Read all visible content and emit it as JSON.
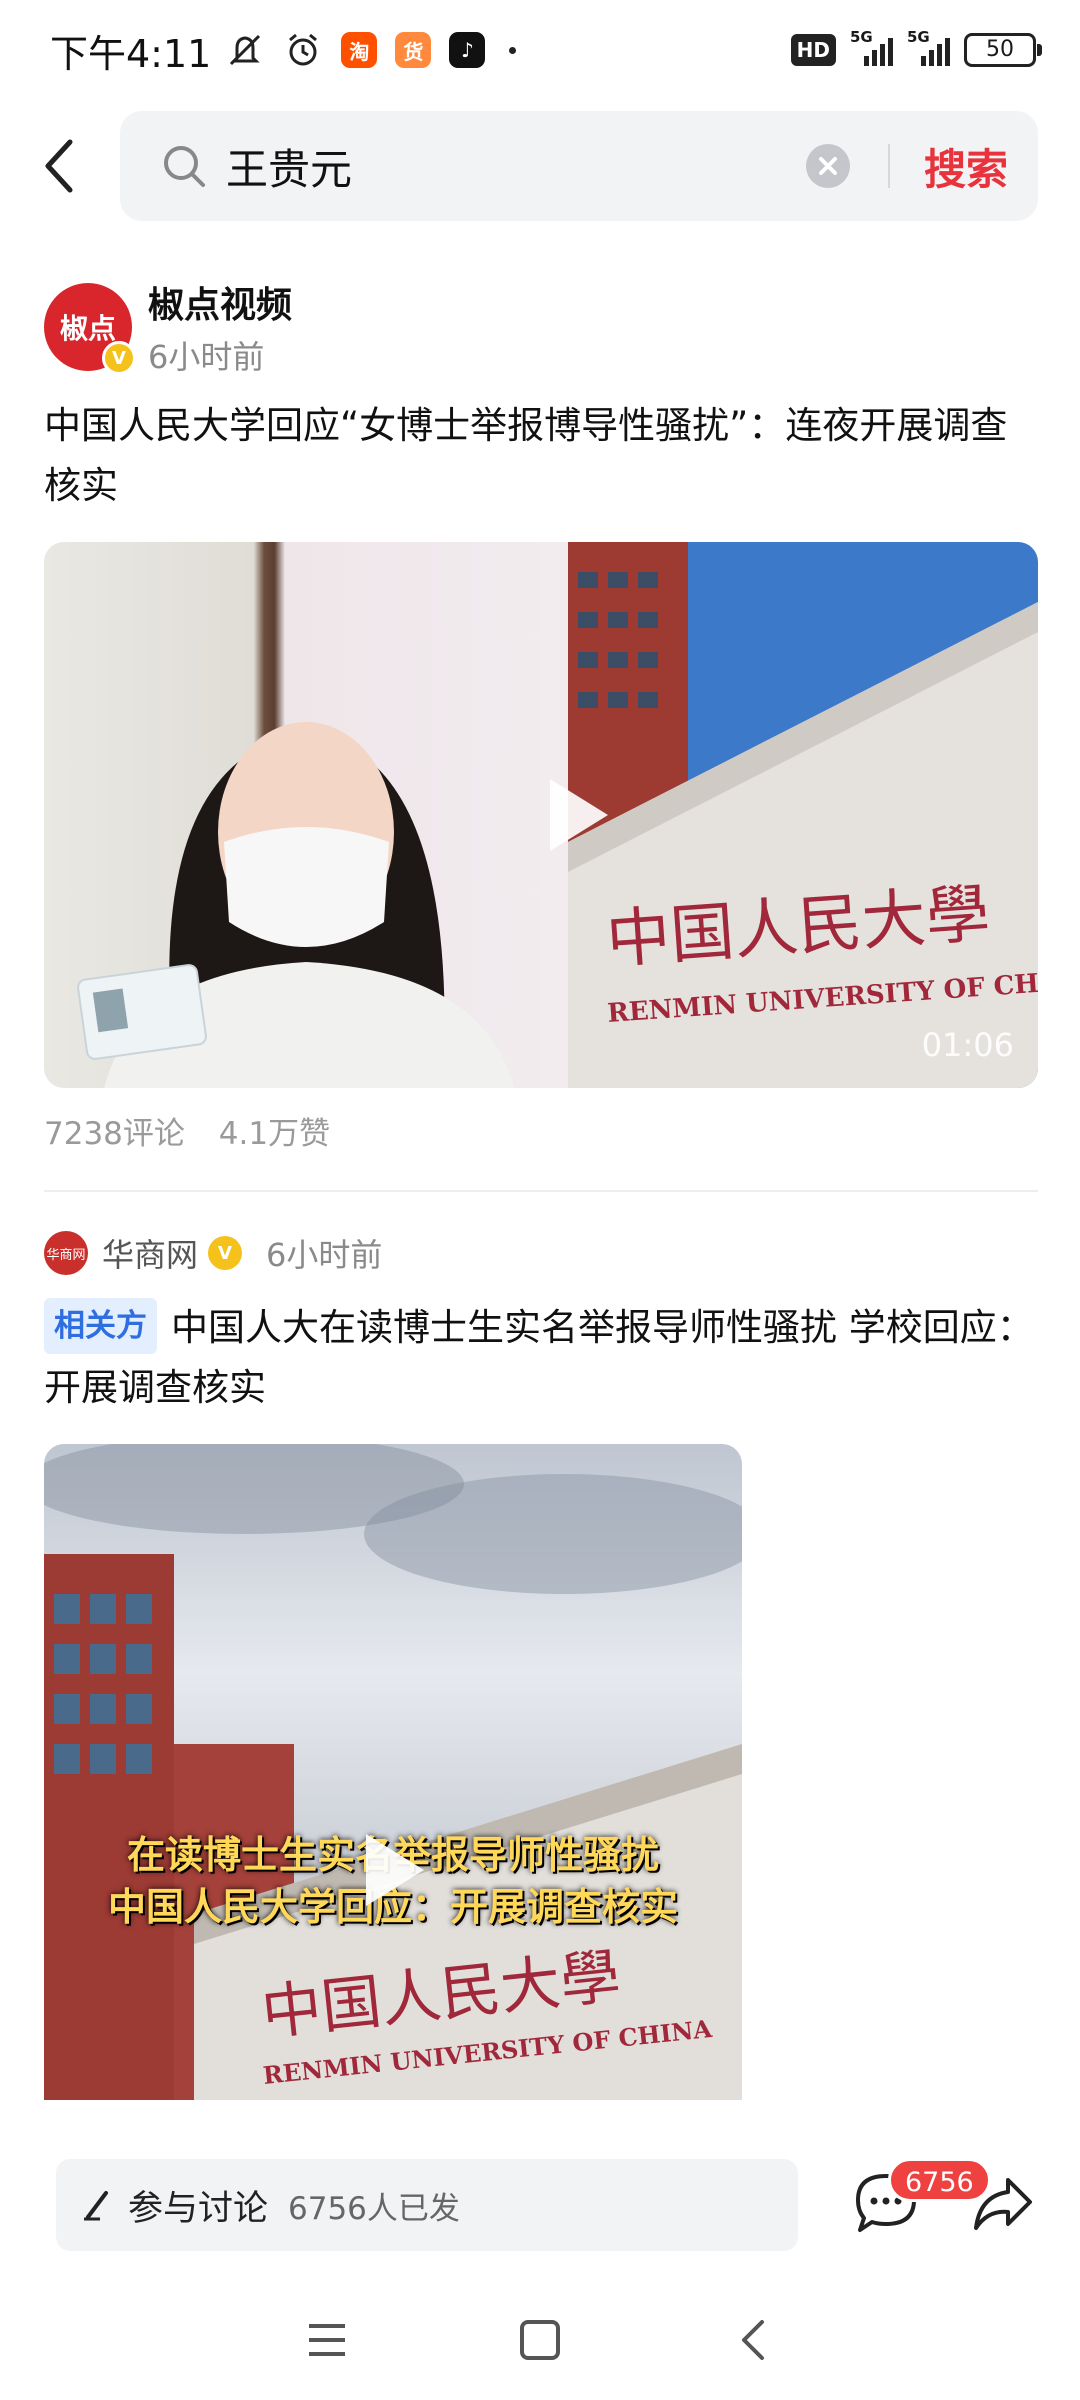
{
  "status_bar": {
    "time": "下午4:11",
    "apps": [
      {
        "name": "taobao-app-icon",
        "glyph": "淘",
        "color": "#ff5000"
      },
      {
        "name": "shopping-app-icon",
        "glyph": "货",
        "color": "#ff8a3d"
      },
      {
        "name": "tiktok-app-icon",
        "glyph": "♪",
        "color": "#111111"
      }
    ],
    "hd_label": "HD",
    "network_1": "5G",
    "network_2": "5G",
    "battery": "50"
  },
  "search": {
    "query": "王贵元",
    "submit_label": "搜索"
  },
  "posts": [
    {
      "author": "椒点视频",
      "avatar_text": "椒点",
      "verified_mark": "V",
      "time": "6小时前",
      "headline": "中国人民大学回应“女博士举报博导性骚扰”：连夜开展调查核实",
      "duration": "01:06",
      "comments": "7238评论",
      "likes": "4.1万赞",
      "sign_cn": "中国人民大學",
      "sign_en": "RENMIN UNIVERSITY OF CHINA"
    },
    {
      "author": "华商网",
      "avatar_text": "华商网",
      "verified_mark": "V",
      "time": "6小时前",
      "tag": "相关方",
      "headline": "中国人大在读博士生实名举报导师性骚扰 学校回应：开展调查核实",
      "overlay_line1": "在读博士生实名举报导师性骚扰",
      "overlay_line2": "中国人民大学回应：开展调查核实",
      "sign_cn": "中国人民大學",
      "sign_en": "RENMIN UNIVERSITY OF CHINA"
    }
  ],
  "comment_bar": {
    "label": "参与讨论",
    "count": "6756人已发",
    "badge": "6756"
  },
  "colors": {
    "accent": "#e8323c",
    "badge": "#f04141",
    "tag_bg": "#e3efff",
    "tag_text": "#2f6ee0",
    "verified": "#f5c21b"
  }
}
